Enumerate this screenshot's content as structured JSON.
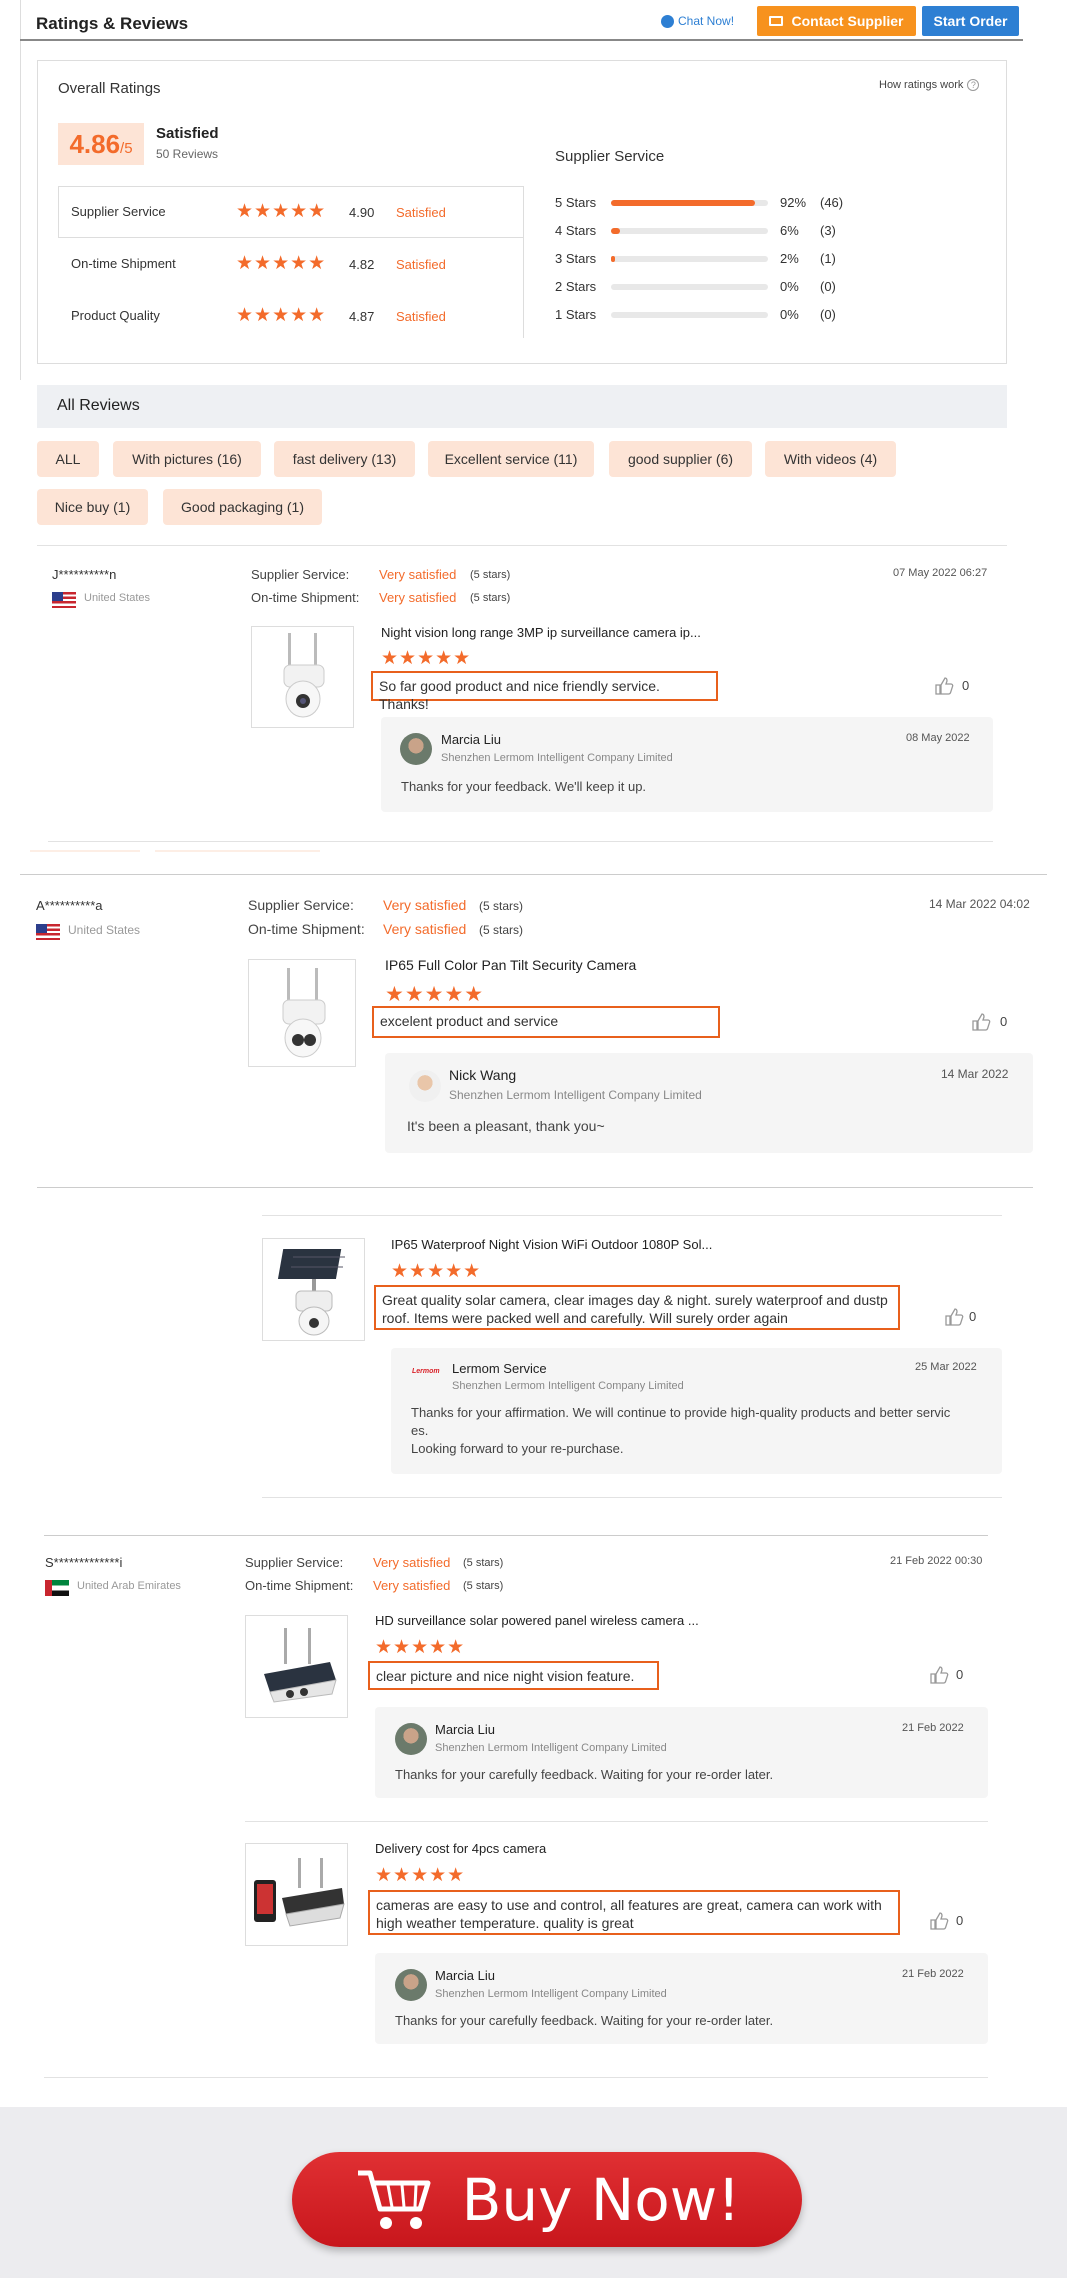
{
  "header": {
    "title": "Ratings & Reviews",
    "chat_label": "Chat Now!",
    "contact_label": "Contact Supplier",
    "start_order_label": "Start Order"
  },
  "overall": {
    "title": "Overall Ratings",
    "how_label": "How ratings work",
    "score": "4.86",
    "score_suffix": "/5",
    "status": "Satisfied",
    "reviews_count": "50 Reviews",
    "rows": [
      {
        "label": "Supplier Service",
        "value": "4.90",
        "status": "Satisfied"
      },
      {
        "label": "On-time Shipment",
        "value": "4.82",
        "status": "Satisfied"
      },
      {
        "label": "Product Quality",
        "value": "4.87",
        "status": "Satisfied"
      }
    ],
    "supplier_service_title": "Supplier Service",
    "distribution": [
      {
        "label": "5 Stars",
        "fraction": 0.92,
        "percent": "92%",
        "count": "(46)"
      },
      {
        "label": "4 Stars",
        "fraction": 0.06,
        "percent": "6%",
        "count": "(3)"
      },
      {
        "label": "3 Stars",
        "fraction": 0.02,
        "percent": "2%",
        "count": "(1)"
      },
      {
        "label": "2 Stars",
        "fraction": 0.0,
        "percent": "0%",
        "count": "(0)"
      },
      {
        "label": "1 Stars",
        "fraction": 0.0,
        "percent": "0%",
        "count": "(0)"
      }
    ]
  },
  "all_reviews": {
    "title": "All Reviews",
    "filters": [
      "ALL",
      "With pictures (16)",
      "fast delivery (13)",
      "Excellent service (11)",
      "good supplier (6)",
      "With videos (4)",
      "Nice buy (1)",
      "Good packaging (1)"
    ]
  },
  "labels": {
    "supplier_service": "Supplier Service:",
    "ontime_shipment": "On-time Shipment:",
    "very_satisfied": "Very satisfied",
    "five_stars": "(5 stars)",
    "company": "Shenzhen Lermom Intelligent Company Limited",
    "stars": "★★★★★"
  },
  "reviews": [
    {
      "user": "J**********n",
      "country": "United States",
      "date": "07 May 2022 06:27",
      "product": "Night vision long range 3MP ip surveillance camera ip...",
      "text": "So far good product and nice friendly service. Thanks!",
      "likes": "0",
      "reply_name": "Marcia Liu",
      "reply_date": "08 May 2022",
      "reply_text": "Thanks for your feedback. We'll keep it up."
    },
    {
      "user": "A**********a",
      "country": "United States",
      "date": "14 Mar 2022 04:02",
      "product": "IP65 Full Color Pan Tilt Security Camera",
      "text": "excelent product and service",
      "likes": "0",
      "reply_name": "Nick Wang",
      "reply_date": "14 Mar 2022",
      "reply_text": "It's been a pleasant, thank you~"
    },
    {
      "product": "IP65 Waterproof Night Vision WiFi Outdoor 1080P Sol...",
      "text_line1": "Great quality solar camera, clear images day & night. surely waterproof and dustp",
      "text_line2": "roof. Items were packed well and carefully. Will surely order again",
      "likes": "0",
      "reply_logo": "Lermom",
      "reply_name": "Lermom Service",
      "reply_date": "25 Mar 2022",
      "reply_line1": "Thanks for your affirmation. We will continue to provide high-quality products and better servic",
      "reply_line2": "es.",
      "reply_line3": "Looking forward to your re-purchase."
    },
    {
      "user": "S*************i",
      "country": "United Arab Emirates",
      "date": "21 Feb 2022 00:30",
      "product": "HD surveillance solar powered panel wireless camera ...",
      "text": "clear picture and nice night vision feature.",
      "likes": "0",
      "reply_name": "Marcia Liu",
      "reply_date": "21 Feb 2022",
      "reply_text": "Thanks for your carefully feedback.  Waiting for your re-order later."
    },
    {
      "product": "Delivery cost for 4pcs camera",
      "text_line1": "cameras are easy to use and control, all features are great, camera can work with",
      "text_line2": "high weather temperature. quality is great",
      "likes": "0",
      "reply_name": "Marcia Liu",
      "reply_date": "21 Feb 2022",
      "reply_text": "Thanks for your carefully feedback.  Waiting for your re-order later."
    }
  ],
  "buy_now": {
    "label": "Buy Now!"
  },
  "colors": {
    "accent": "#f36b2b",
    "contact_button": "#f7921e",
    "start_button": "#2d7fd3",
    "buy_button": "#d92128"
  }
}
